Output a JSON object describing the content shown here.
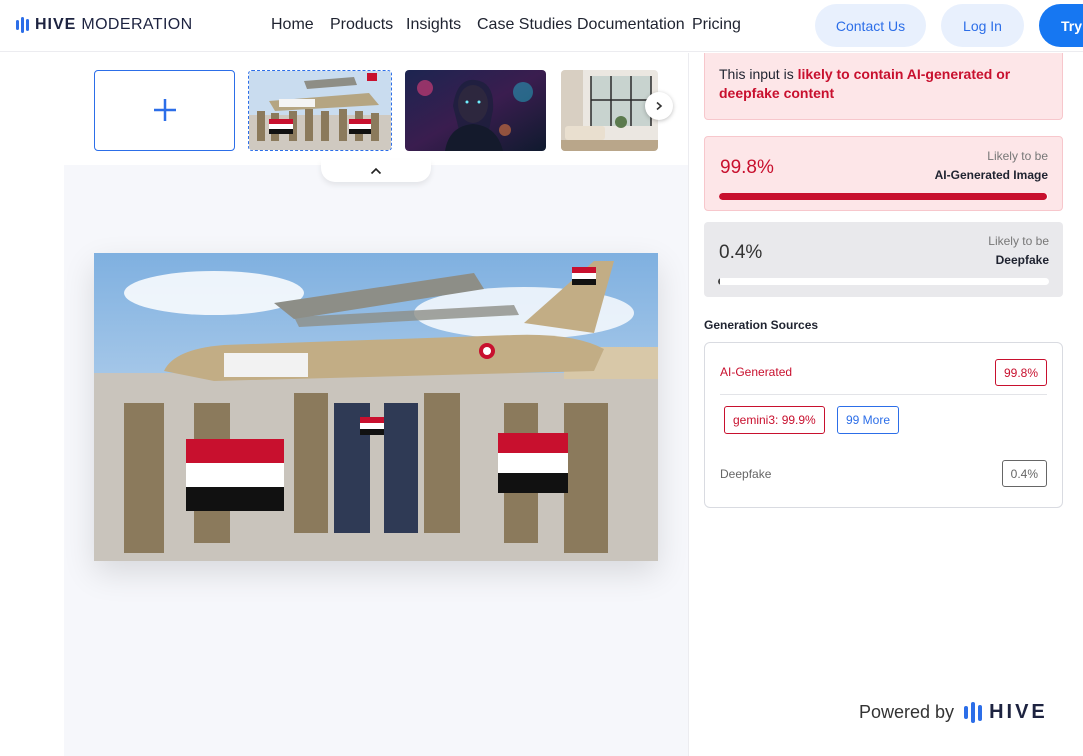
{
  "header": {
    "brand": "HIVE",
    "brand_sub": "MODERATION",
    "nav": [
      {
        "label": "Home"
      },
      {
        "label": "Products"
      },
      {
        "label": "Insights"
      },
      {
        "label": "Case Studies"
      },
      {
        "label": "Documentation"
      },
      {
        "label": "Pricing"
      }
    ],
    "contact_label": "Contact Us",
    "login_label": "Log In",
    "try_label": "Try"
  },
  "gallery": {
    "upload_icon": "plus-icon",
    "next_icon": "chevron-right-icon",
    "collapse_icon": "chevron-up-icon",
    "thumbnails": [
      {
        "subject": "soldiers-with-flags-photo",
        "selected": true
      },
      {
        "subject": "neon-portrait-photo",
        "selected": false
      },
      {
        "subject": "interior-room-photo",
        "selected": false
      }
    ]
  },
  "result": {
    "verdict_prefix": "This input is ",
    "verdict_highlight": "likely to contain AI-generated or deepfake content",
    "scores": [
      {
        "value": "99.8%",
        "kicker": "Likely to be",
        "label": "AI-Generated Image",
        "fraction": 0.998
      },
      {
        "value": "0.4%",
        "kicker": "Likely to be",
        "label": "Deepfake",
        "fraction": 0.004
      }
    ],
    "sources_title": "Generation Sources",
    "sources": {
      "ai_label": "AI-Generated",
      "ai_value": "99.8%",
      "model_tag": "gemini3: 99.9%",
      "more_tag": "99 More",
      "df_label": "Deepfake",
      "df_value": "0.4%"
    }
  },
  "footer": {
    "powered_text": "Powered by",
    "powered_brand": "HIVE"
  },
  "colors": {
    "accent": "#2c6ee8",
    "alert": "#c8102e",
    "alert_bg": "#fde6e8"
  }
}
